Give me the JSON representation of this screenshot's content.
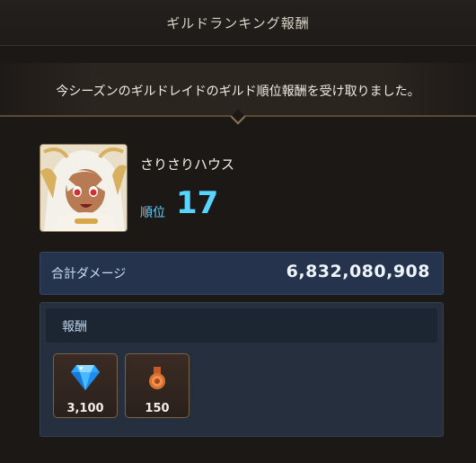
{
  "header": {
    "title": "ギルドランキング報酬"
  },
  "notice": {
    "message": "今シーズンのギルドレイドのギルド順位報酬を受け取りました。"
  },
  "guild": {
    "name": "さりさりハウス",
    "rank_label": "順位",
    "rank_value": "17"
  },
  "damage": {
    "label": "合計ダメージ",
    "value": "6,832,080,908"
  },
  "rewards": {
    "label": "報酬",
    "items": [
      {
        "icon": "diamond-gem-icon",
        "qty": "3,100"
      },
      {
        "icon": "medal-icon",
        "qty": "150"
      }
    ]
  },
  "colors": {
    "accent": "#56d6ff",
    "panel": "#25344c",
    "item_border": "#7a6248"
  }
}
